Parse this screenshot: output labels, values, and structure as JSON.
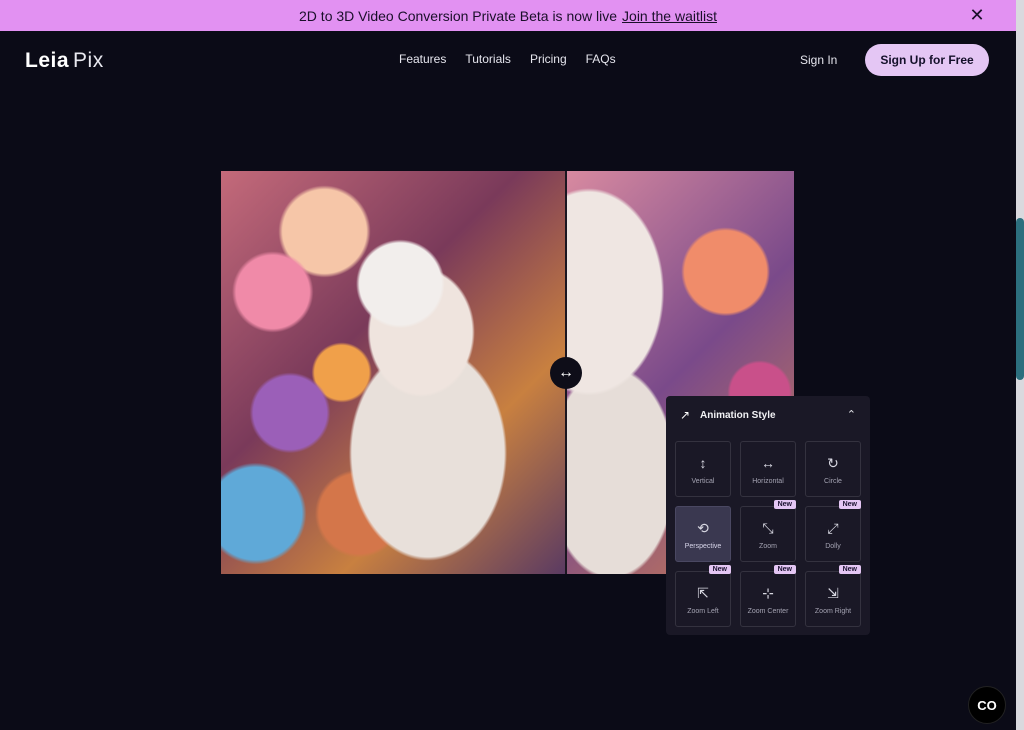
{
  "banner": {
    "text": "2D to 3D Video Conversion Private Beta is now live",
    "link": "Join the waitlist",
    "close_icon": "close-icon"
  },
  "nav": {
    "logo_part1": "Leia",
    "logo_part2": "Pix",
    "links": [
      "Features",
      "Tutorials",
      "Pricing",
      "FAQs"
    ],
    "signin": "Sign In",
    "signup": "Sign Up for Free"
  },
  "compare": {
    "handle_icon": "↔"
  },
  "panel": {
    "title": "Animation Style",
    "header_icon": "↗",
    "collapse_icon": "⌃",
    "options": [
      {
        "label": "Vertical",
        "icon": "↕",
        "new": false,
        "selected": false
      },
      {
        "label": "Horizontal",
        "icon": "↔",
        "new": false,
        "selected": false
      },
      {
        "label": "Circle",
        "icon": "↻",
        "new": false,
        "selected": false
      },
      {
        "label": "Perspective",
        "icon": "⟲",
        "new": false,
        "selected": true
      },
      {
        "label": "Zoom",
        "icon": "⤡",
        "new": true,
        "selected": false
      },
      {
        "label": "Dolly",
        "icon": "⤢",
        "new": true,
        "selected": false
      },
      {
        "label": "Zoom Left",
        "icon": "⇱",
        "new": true,
        "selected": false
      },
      {
        "label": "Zoom Center",
        "icon": "⊹",
        "new": true,
        "selected": false
      },
      {
        "label": "Zoom Right",
        "icon": "⇲",
        "new": true,
        "selected": false
      }
    ],
    "badge_label": "New"
  },
  "chat": {
    "label": "CO"
  },
  "colors": {
    "background": "#0b0b17",
    "banner": "#e291f2",
    "accent": "#e4c6f4",
    "panel": "#1a1826"
  }
}
